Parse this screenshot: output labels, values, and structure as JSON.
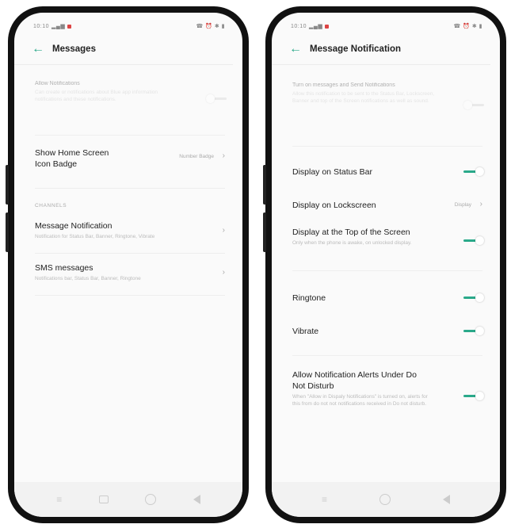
{
  "colors": {
    "accent": "#2aa98a",
    "frame": "#111111",
    "background": "#fafafa"
  },
  "left": {
    "status": {
      "time": "10:10",
      "icons_right": "☎ ⏰ ✱ ▮"
    },
    "title": "Messages",
    "faded_row": {
      "label": "Allow Notifications",
      "sub": "Can create or notifications about Blue app information notifications and these notifications."
    },
    "badge_row": {
      "label_line1": "Show Home Screen",
      "label_line2": "Icon Badge",
      "value": "Number Badge"
    },
    "section": "CHANNELS",
    "channels": [
      {
        "label": "Message Notification",
        "sub": "Notification for Status Bar, Banner, Ringtone, Vibrate"
      },
      {
        "label": "SMS messages",
        "sub": "Notifications bar, Status Bar, Banner, Ringtone"
      }
    ]
  },
  "right": {
    "status": {
      "time": "10:10",
      "icons_right": "☎ ⏰ ✱ ▮"
    },
    "title": "Message Notification",
    "faded_row": {
      "label": "Turn on messages and Send Notifications",
      "sub": "Allow this notification to be sent to the Status Bar, Lockscreen, Banner and top of the Screen notifications as well as sound."
    },
    "rows": {
      "status_bar": "Display on Status Bar",
      "lockscreen": "Display on Lockscreen",
      "lockscreen_value": "Display",
      "top_screen": "Display at the Top of the Screen",
      "top_screen_sub": "Only when the phone is awake, on unlocked display.",
      "ringtone": "Ringtone",
      "vibrate": "Vibrate",
      "dnd_line1": "Allow Notification Alerts Under Do",
      "dnd_line2": "Not Disturb",
      "dnd_sub": "When \"Allow in Dispaly Notifications\" is turned on, alerts for this from do not not notifications received in Do not disturb."
    }
  },
  "icons": {
    "back": "←",
    "chevron": "›",
    "nav_back": "back-triangle",
    "nav_home": "home-circle",
    "nav_recent": "recent-square",
    "menu": "menu-lines"
  }
}
